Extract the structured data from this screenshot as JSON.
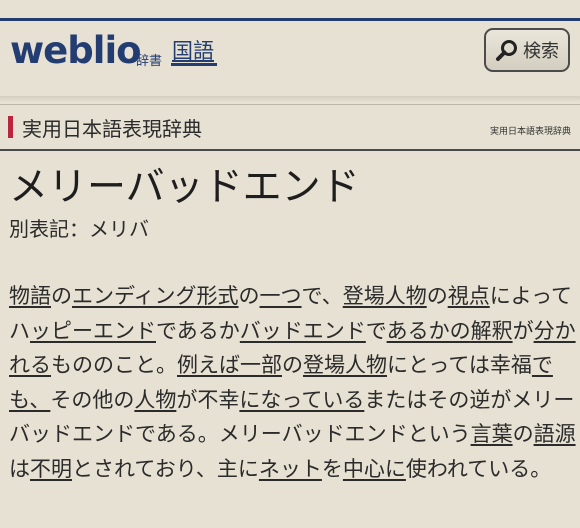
{
  "header": {
    "logo": "weblio",
    "logo_sub": "辞書",
    "tab_label": "国語",
    "search_label": "検索"
  },
  "section": {
    "title": "実用日本語表現辞典",
    "source_small": "実用日本語表現辞典"
  },
  "entry": {
    "headword": "メリーバッドエンド",
    "alt_notation": "別表記：メリバ",
    "body": [
      {
        "t": "物語",
        "link": true
      },
      {
        "t": "の",
        "link": false
      },
      {
        "t": "エンディング",
        "link": true
      },
      {
        "t": "形式",
        "link": true
      },
      {
        "t": "の",
        "link": false
      },
      {
        "t": "一つ",
        "link": true
      },
      {
        "t": "で、",
        "link": false
      },
      {
        "t": "登場人物",
        "link": true
      },
      {
        "t": "の",
        "link": false
      },
      {
        "t": "視点",
        "link": true
      },
      {
        "t": "によってハ",
        "link": false
      },
      {
        "t": "ッピーエンド",
        "link": true
      },
      {
        "t": "であるか",
        "link": false
      },
      {
        "t": "バッドエンド",
        "link": true
      },
      {
        "t": "で",
        "link": false
      },
      {
        "t": "あるかの",
        "link": true
      },
      {
        "t": "解釈",
        "link": true
      },
      {
        "t": "が",
        "link": false
      },
      {
        "t": "分かれる",
        "link": true
      },
      {
        "t": "もののこと。",
        "link": false
      },
      {
        "t": "例えば",
        "link": true
      },
      {
        "t": "一部",
        "link": true
      },
      {
        "t": "の",
        "link": false
      },
      {
        "t": "登場人物",
        "link": true
      },
      {
        "t": "にとっては幸福",
        "link": false
      },
      {
        "t": "でも、",
        "link": true
      },
      {
        "t": "その他の",
        "link": false
      },
      {
        "t": "人物",
        "link": true
      },
      {
        "t": "が不幸",
        "link": false
      },
      {
        "t": "になっている",
        "link": true
      },
      {
        "t": "またはその逆がメリーバッドエンドである。メリーバッドエンドという",
        "link": false
      },
      {
        "t": "言葉",
        "link": true
      },
      {
        "t": "の",
        "link": false
      },
      {
        "t": "語源",
        "link": true
      },
      {
        "t": "は",
        "link": false
      },
      {
        "t": "不明",
        "link": true
      },
      {
        "t": "とされており、主に",
        "link": false
      },
      {
        "t": "ネット",
        "link": true
      },
      {
        "t": "を",
        "link": false
      },
      {
        "t": "中心に",
        "link": true
      },
      {
        "t": "使われている。",
        "link": false
      }
    ]
  },
  "colors": {
    "background": "#e6e1d2",
    "brand": "#233d73",
    "accent_bar": "#b8253c"
  },
  "icons": {
    "search": "magnifier-icon"
  }
}
